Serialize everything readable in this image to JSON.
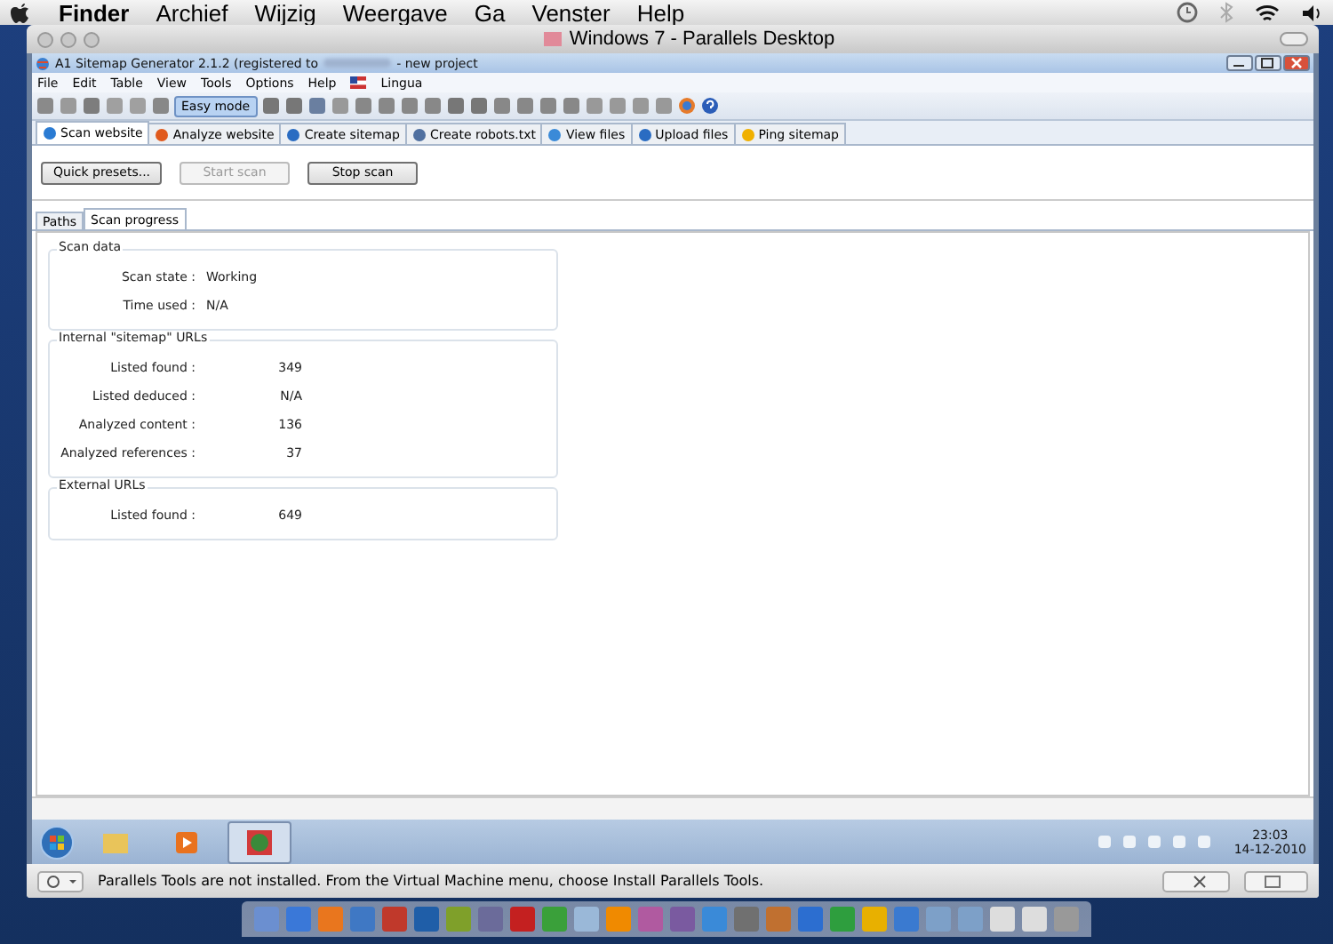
{
  "mac_menubar": {
    "menus": [
      "Finder",
      "Archief",
      "Wijzig",
      "Weergave",
      "Ga",
      "Venster",
      "Help"
    ]
  },
  "window": {
    "title": "Windows 7 - Parallels Desktop"
  },
  "app": {
    "title_start": "A1 Sitemap Generator 2.1.2 (registered to",
    "title_end": "- new project",
    "menus": [
      "File",
      "Edit",
      "Table",
      "View",
      "Tools",
      "Options",
      "Help",
      "Lingua"
    ],
    "easy_mode": {
      "label": "Easy mode",
      "pressed": true
    },
    "tabs": [
      {
        "label": "Scan website",
        "selected": true
      },
      {
        "label": "Analyze website",
        "selected": false
      },
      {
        "label": "Create sitemap",
        "selected": false
      },
      {
        "label": "Create robots.txt",
        "selected": false
      },
      {
        "label": "View files",
        "selected": false
      },
      {
        "label": "Upload files",
        "selected": false
      },
      {
        "label": "Ping sitemap",
        "selected": false
      }
    ],
    "buttons": [
      {
        "label": "Quick presets...",
        "disabled": false
      },
      {
        "label": "Start scan",
        "disabled": true
      },
      {
        "label": "Stop scan",
        "disabled": false
      }
    ],
    "subtabs": [
      {
        "label": "Paths",
        "selected": false
      },
      {
        "label": "Scan progress",
        "selected": true
      }
    ],
    "groups": [
      {
        "title": "Scan data",
        "rows": [
          {
            "label": "Scan state :",
            "value": "Working"
          },
          {
            "label": "Time used :",
            "value": "N/A"
          }
        ]
      },
      {
        "title": "Internal \"sitemap\" URLs",
        "rows": [
          {
            "label": "Listed found :",
            "value": "349"
          },
          {
            "label": "Listed deduced :",
            "value": "N/A"
          },
          {
            "label": "Analyzed content :",
            "value": "136"
          },
          {
            "label": "Analyzed references :",
            "value": "37"
          }
        ]
      },
      {
        "title": "External URLs",
        "rows": [
          {
            "label": "Listed found :",
            "value": "649"
          }
        ]
      }
    ]
  },
  "taskbar": {
    "apps": [
      {
        "selected": false
      },
      {
        "selected": false
      },
      {
        "selected": true
      }
    ],
    "time": "23:03",
    "date": "14-12-2010"
  },
  "status_bar": {
    "message": "Parallels Tools are not installed. From the Virtual Machine menu, choose Install Parallels Tools."
  }
}
